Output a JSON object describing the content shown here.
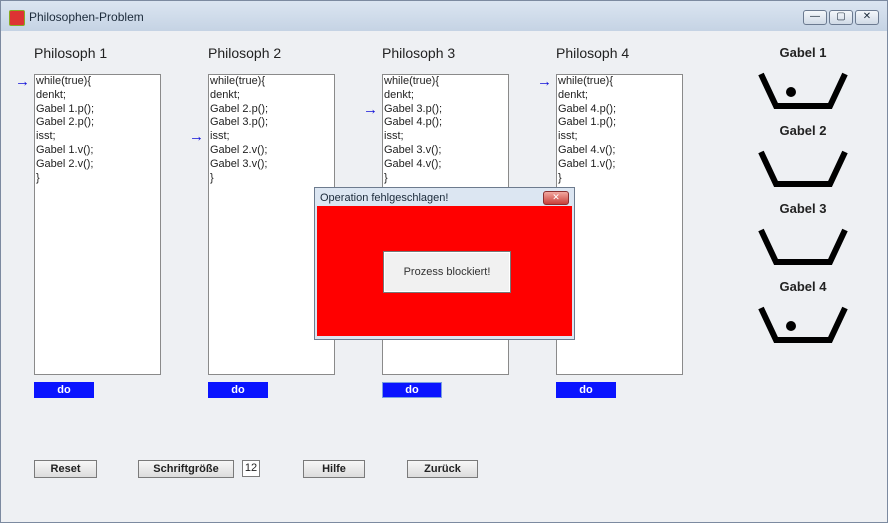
{
  "window": {
    "title": "Philosophen-Problem",
    "controls": [
      "—",
      "▢",
      "✕"
    ]
  },
  "philosophers": [
    {
      "title": "Philosoph 1",
      "code": [
        "while(true){",
        "denkt;",
        "Gabel 1.p();",
        "Gabel 2.p();",
        "isst;",
        "Gabel 1.v();",
        "Gabel 2.v();",
        "}"
      ],
      "arrow_line": 0,
      "button": "do"
    },
    {
      "title": "Philosoph 2",
      "code": [
        "while(true){",
        "denkt;",
        "Gabel 2.p();",
        "Gabel 3.p();",
        "isst;",
        "Gabel 2.v();",
        "Gabel 3.v();",
        "}"
      ],
      "arrow_line": 4,
      "button": "do"
    },
    {
      "title": "Philosoph 3",
      "code": [
        "while(true){",
        "denkt;",
        "Gabel 3.p();",
        "Gabel 4.p();",
        "isst;",
        "Gabel 3.v();",
        "Gabel 4.v();",
        "}"
      ],
      "arrow_line": 2,
      "button": "do"
    },
    {
      "title": "Philosoph 4",
      "code": [
        "while(true){",
        "denkt;",
        "Gabel 4.p();",
        "Gabel 1.p();",
        "isst;",
        "Gabel 4.v();",
        "Gabel 1.v();",
        "}"
      ],
      "arrow_line": 0,
      "button": "do"
    }
  ],
  "forks": [
    {
      "label": "Gabel 1",
      "has_token": true
    },
    {
      "label": "Gabel 2",
      "has_token": false
    },
    {
      "label": "Gabel 3",
      "has_token": false
    },
    {
      "label": "Gabel 4",
      "has_token": true
    }
  ],
  "bottom": {
    "reset": "Reset",
    "font_size_label": "Schriftgröße",
    "font_size_value": "12",
    "help": "Hilfe",
    "back": "Zurück"
  },
  "dialog": {
    "title": "Operation fehlgeschlagen!",
    "close": "✕",
    "message": "Prozess blockiert!",
    "bg_color": "#ff0000"
  },
  "colors": {
    "arrow": "#1010d8",
    "do_button": "#0a14ff"
  }
}
